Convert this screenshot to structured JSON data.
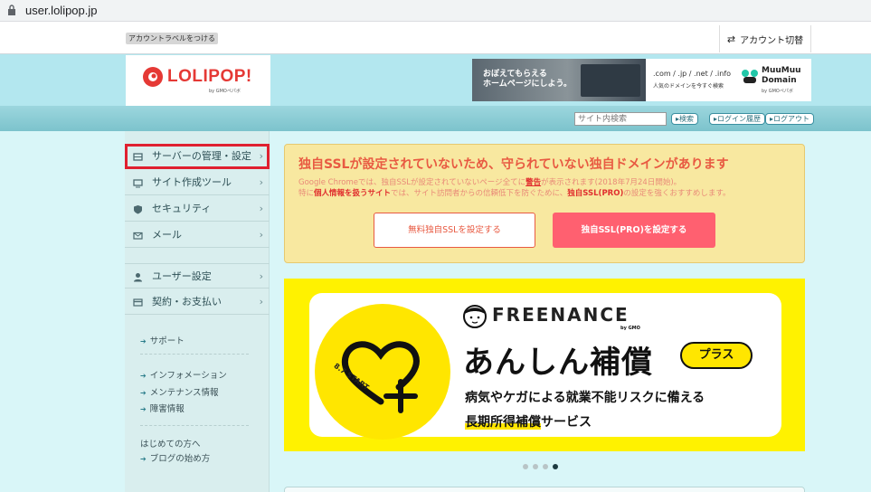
{
  "browser": {
    "url": "user.lolipop.jp"
  },
  "topbar": {
    "account_label_button": "アカウントラベルをつける",
    "account_switch": "アカウント切替"
  },
  "header": {
    "logo_text": "LOLIPOP!",
    "logo_sub": "by GMOペパボ",
    "banner_a_text": "おぼえてもらえる\nホームページにしよう。",
    "banner_b_domains": ".com / .jp / .net / .info",
    "banner_b_tagline": "人気のドメインを今すぐ検索",
    "banner_b_brand": "MuuMuu\nDomain",
    "banner_b_brand_sub": "by GMOペパボ"
  },
  "nav": {
    "search_placeholder": "サイト内検索",
    "search_button": "検索",
    "login_history": "ログイン履歴",
    "logout": "ログアウト"
  },
  "sidebar": {
    "items": [
      {
        "label": "サーバーの管理・設定",
        "icon": "server-icon"
      },
      {
        "label": "サイト作成ツール",
        "icon": "monitor-icon"
      },
      {
        "label": "セキュリティ",
        "icon": "shield-icon"
      },
      {
        "label": "メール",
        "icon": "mail-icon"
      },
      {
        "label": "ユーザー設定",
        "icon": "user-icon"
      },
      {
        "label": "契約・お支払い",
        "icon": "card-icon"
      }
    ],
    "links": {
      "support": "サポート",
      "information": "インフォメーション",
      "maintenance": "メンテナンス情報",
      "incident": "障害情報",
      "beginners": "はじめての方へ",
      "blog_start": "ブログの始め方"
    }
  },
  "notice": {
    "title": "独自SSLが設定されていないため、守られていない独自ドメインがあります",
    "line1_a": "Google Chromeでは、独自SSLが設定されていないページ全てに",
    "line1_warn": "警告",
    "line1_b": "が表示されます(2018年7月24日開始)。",
    "line2_a": "特に",
    "line2_bold": "個人情報を扱うサイト",
    "line2_b": "では、サイト訪問者からの信頼低下を防ぐために、",
    "line2_bold2": "独自SSL(PRO)",
    "line2_c": "の設定を強くおすすめします。",
    "btn_free": "無料独自SSLを設定する",
    "btn_pro": "独自SSL(PRO)を設定する"
  },
  "ad": {
    "brand": "FREENANCE",
    "brand_sub": "by GMO",
    "badge": "8.7 START",
    "headline": "あんしん補償",
    "plus": "プラス",
    "line1": "病気やケガによる就業不能リスクに備える",
    "line2_hl": "長期所得補償",
    "line2_rest": "サービス"
  },
  "carousel": {
    "count": 4,
    "active": 4
  },
  "colors": {
    "accent": "#e85a42",
    "pro": "#ff6070",
    "header": "#b3e7ef",
    "ad_yellow": "#fff200"
  }
}
